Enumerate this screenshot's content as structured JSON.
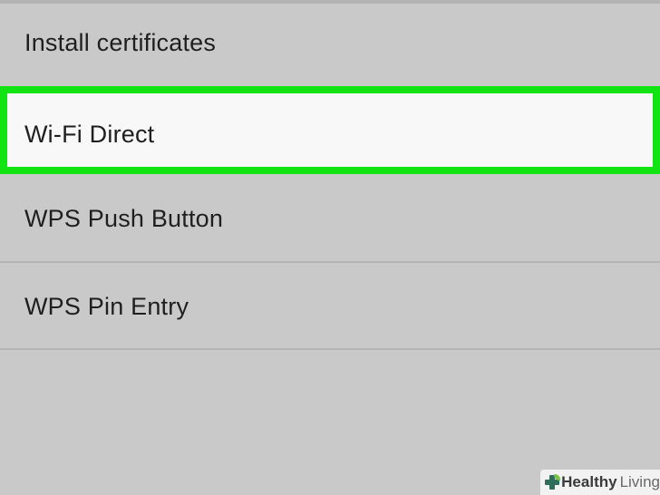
{
  "settings_list": {
    "items": [
      {
        "label": "Install certificates",
        "highlighted": false
      },
      {
        "label": "Wi-Fi Direct",
        "highlighted": true
      },
      {
        "label": "WPS Push Button",
        "highlighted": false
      },
      {
        "label": "WPS Pin Entry",
        "highlighted": false
      }
    ]
  },
  "colors": {
    "background": "#c9c9c9",
    "highlight_border": "#12e312",
    "highlight_fill": "#f8f8f8",
    "divider": "#b4b4b4",
    "text": "#1f1f1f"
  },
  "watermark": {
    "icon": "healthy-living-cross-icon",
    "brand_strong": "Healthy",
    "brand_light": "Living"
  }
}
